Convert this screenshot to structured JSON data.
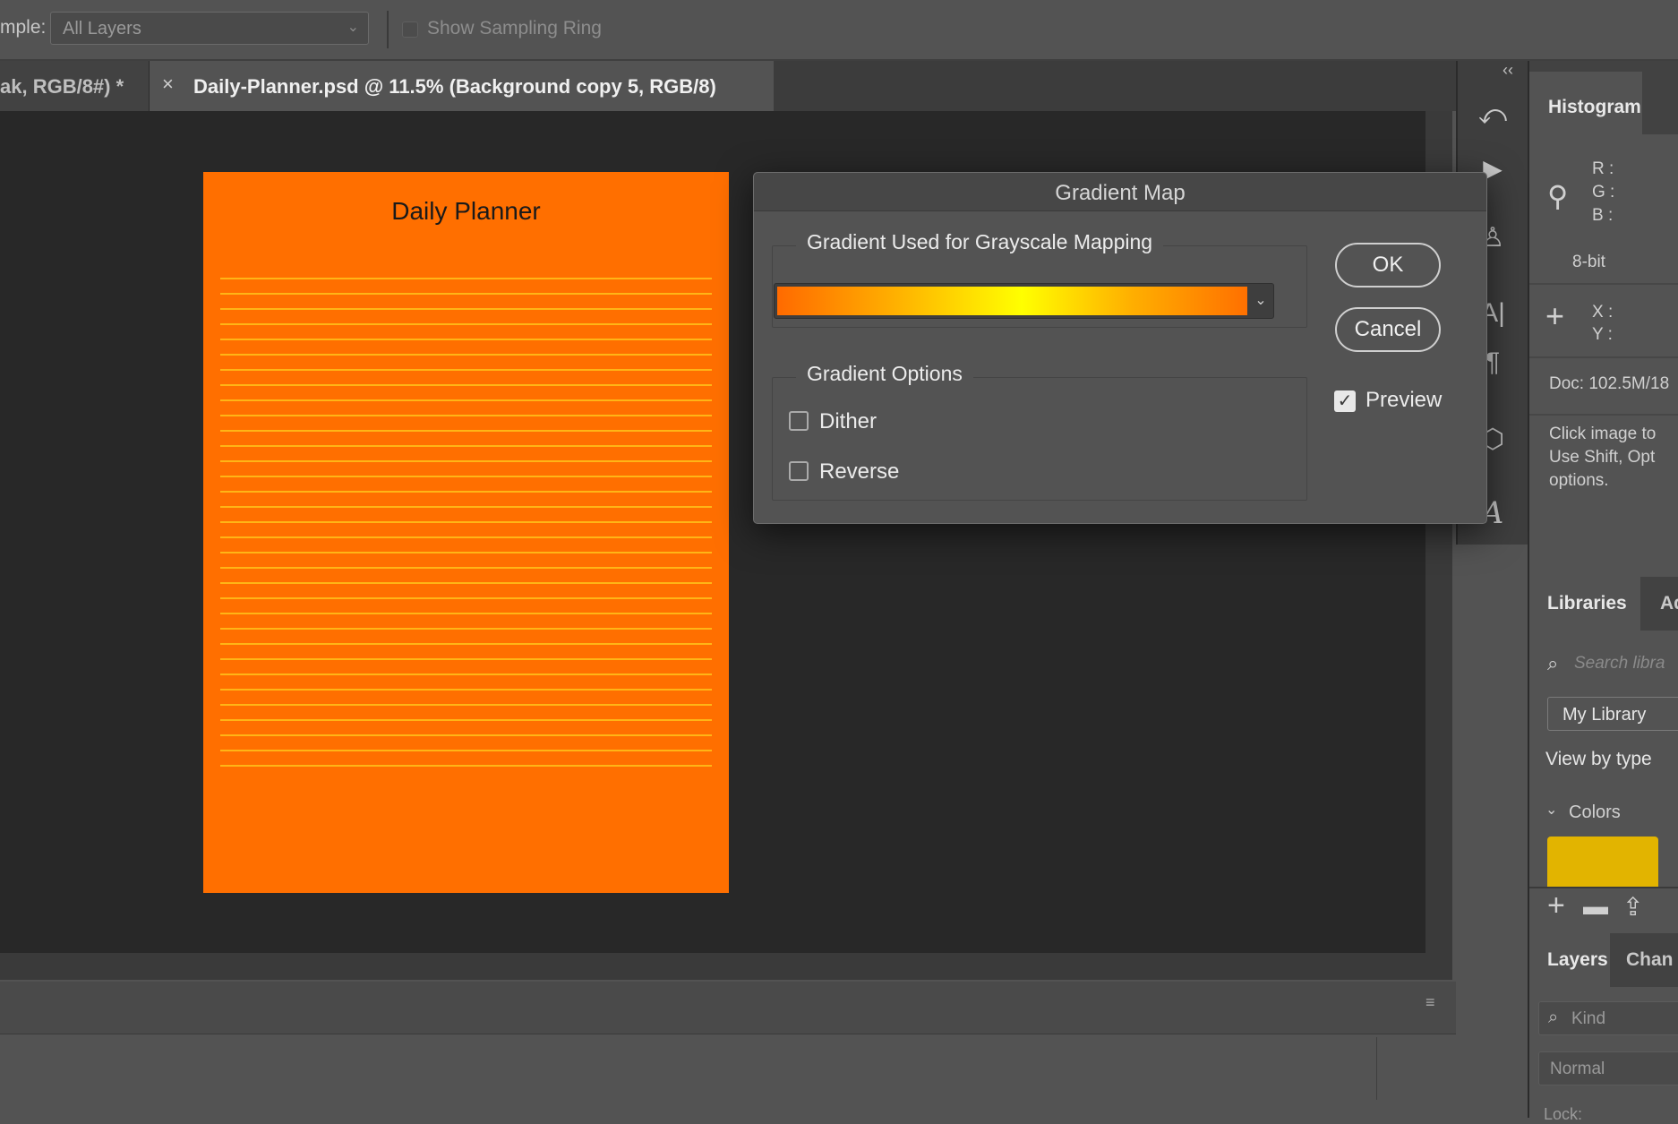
{
  "options_bar": {
    "sample_label": "mple:",
    "sample_value": "All Layers",
    "show_sampling_ring": "Show Sampling Ring"
  },
  "tabs": [
    {
      "label": "ak, RGB/8#) *"
    },
    {
      "close": "×",
      "label": "Daily-Planner.psd @ 11.5% (Background copy 5, RGB/8)"
    }
  ],
  "document": {
    "title": "Daily Planner",
    "bg_color": "#ff6f00",
    "line_color": "#ffc21a"
  },
  "dialog": {
    "title": "Gradient Map",
    "gradient_group_label": "Gradient Used for Grayscale Mapping",
    "options_group_label": "Gradient Options",
    "dither_label": "Dither",
    "reverse_label": "Reverse",
    "ok_label": "OK",
    "cancel_label": "Cancel",
    "preview_label": "Preview",
    "dither_checked": false,
    "reverse_checked": false,
    "preview_checked": true
  },
  "histogram": {
    "tab": "Histogram",
    "r": "R :",
    "g": "G :",
    "b": "B :",
    "bit": "8-bit",
    "x": "X :",
    "y": "Y :",
    "doc": "Doc: 102.5M/18",
    "info_line1": "Click image to",
    "info_line2": "Use Shift, Opt",
    "info_line3": "options."
  },
  "libraries": {
    "tab": "Libraries",
    "tab2": "Ad",
    "search_placeholder": "Search libra",
    "library": "My Library",
    "view_by": "View by type",
    "colors_section": "Colors",
    "swatch_color": "#e2b400"
  },
  "layers": {
    "tab": "Layers",
    "tab2": "Chan",
    "kind_placeholder": "Kind",
    "blend_mode": "Normal",
    "lock_label": "Lock:"
  },
  "toolstrip": {
    "collapse": "‹‹"
  }
}
